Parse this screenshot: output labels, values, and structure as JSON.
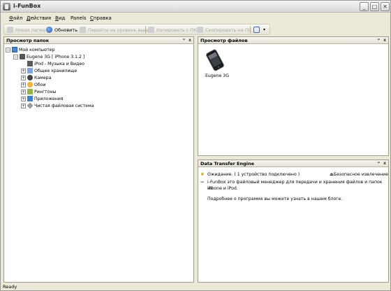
{
  "window": {
    "title": "i-FunBox"
  },
  "menu": [
    {
      "label": "Файл",
      "key": "Ф",
      "rest": "айл"
    },
    {
      "label": "Действия",
      "key": "Д",
      "rest": "ействия"
    },
    {
      "label": "Вид",
      "key": "В",
      "rest": "ид"
    },
    {
      "label": "Panels",
      "key": "",
      "rest": "Panels"
    },
    {
      "label": "Справка",
      "key": "С",
      "rest": "правка"
    }
  ],
  "toolbar": {
    "new_folder": "Новая папка",
    "refresh": "Обновить",
    "go_up": "Перейти на уровень выше",
    "copy_to_pc": "Копировать с ПК",
    "copy_from_pc": "Скопировать на ПК"
  },
  "folders_panel": {
    "title": "Просмотр папок",
    "tree": {
      "root": "Мой компьютер",
      "device": "Eugene 3G [ iPhone 3.1.2 ]",
      "items": [
        "iPod - Музыка и Видео",
        "Общее хранилище",
        "Камера",
        "Обои",
        "Рингтоны",
        "Приложения",
        "Чистая файловая система"
      ]
    }
  },
  "files_panel": {
    "title": "Просмотр файлов",
    "device_label": "Eugene 3G"
  },
  "dte_panel": {
    "title": "Data Transfer Engine",
    "status": "Ожидание. ( 1 устройство подключено )",
    "safe_remove": "Безопасное извлечение",
    "info_line1": "i-FunBox это файловый менеджер для передачи и хранения файлов и папок на",
    "info_line2": "iPhone и iPod.",
    "info_line3": "Подробнее о программе вы можете узнать в нашем блоге."
  },
  "panel_controls": {
    "pin": "ᵖ",
    "close": "x"
  },
  "statusbar": {
    "text": "Ready"
  }
}
